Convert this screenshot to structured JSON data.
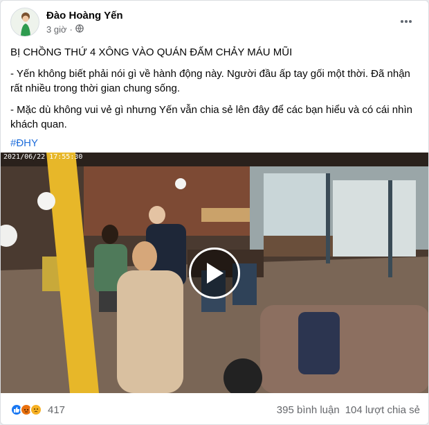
{
  "post": {
    "author": "Đào Hoàng Yến",
    "time": "3 giờ",
    "privacy_icon": "globe-icon",
    "more_icon": "more-options-icon",
    "headline": "BỊ CHỒNG THỨ 4 XÔNG VÀO QUÁN ĐẤM CHẢY MÁU MŨI",
    "paragraphs": [
      "- Yến không biết phải nói gì về hành động này. Người đầu ấp tay gối một thời. Đã nhận rất nhiều trong thời gian chung sống.",
      "- Mặc dù không vui vẻ gì nhưng Yến vẫn chia sẻ lên đây để các bạn hiểu và có cái nhìn khách quan."
    ],
    "hashtag": "#ĐHY"
  },
  "video": {
    "timestamp": "2021/06/22  17:55:30",
    "play_icon": "play-icon"
  },
  "footer": {
    "reaction_icons": [
      "like-icon",
      "angry-icon",
      "sad-icon"
    ],
    "reaction_count": "417",
    "comments": "395 bình luận",
    "shares": "104 lượt chia sẻ"
  },
  "colors": {
    "link": "#216fdb",
    "meta": "#65676b",
    "like": "#1877f2",
    "angry": "#e9710f",
    "sad": "#f7b125"
  }
}
